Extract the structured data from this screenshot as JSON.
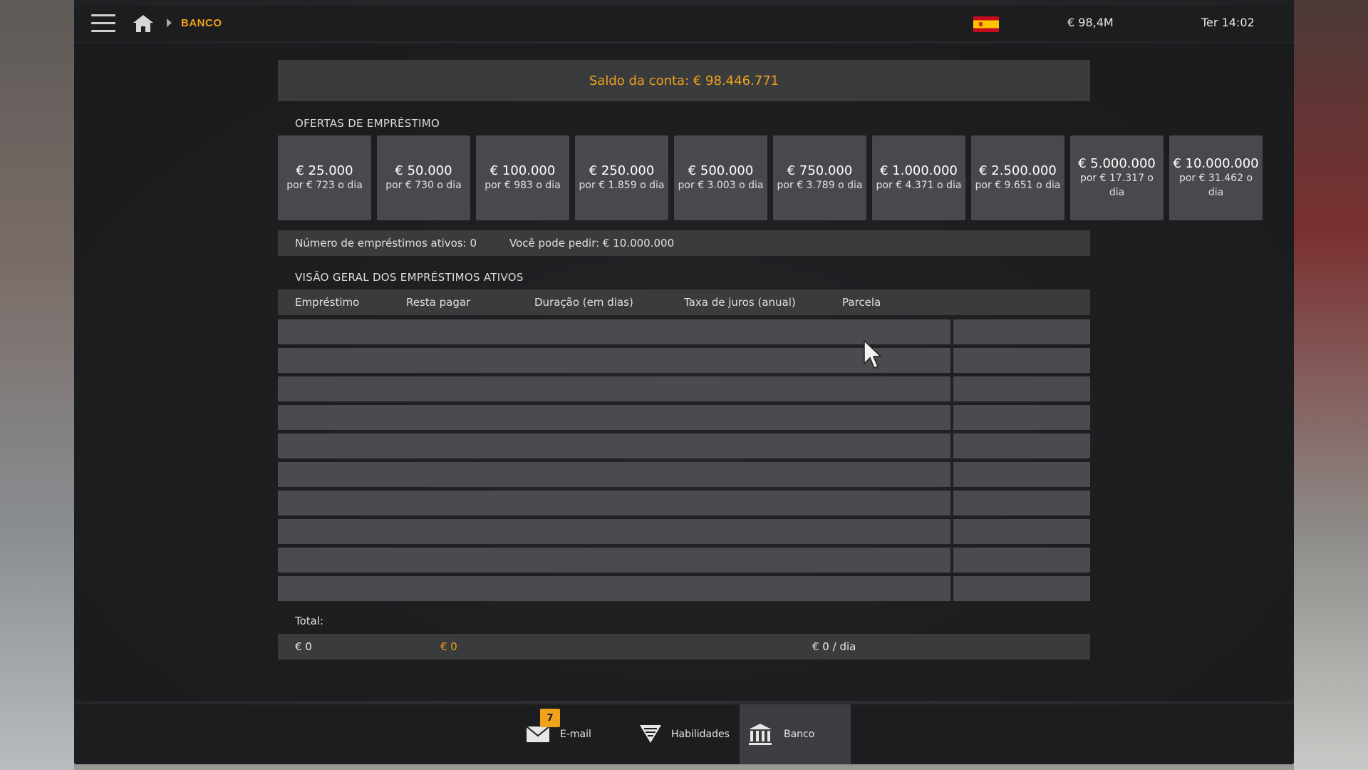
{
  "header": {
    "breadcrumb": "BANCO",
    "money": "€ 98,4M",
    "clock": "Ter 14:02",
    "flag_icon": "spain-flag-icon"
  },
  "balance": {
    "text": "Saldo da conta: € 98.446.771",
    "color": "#f0a21a"
  },
  "offers_title": "OFERTAS DE EMPRÉSTIMO",
  "offers": [
    {
      "amount": "€ 25.000",
      "rate": "por € 723 o dia"
    },
    {
      "amount": "€ 50.000",
      "rate": "por € 730 o dia"
    },
    {
      "amount": "€ 100.000",
      "rate": "por € 983 o dia"
    },
    {
      "amount": "€ 250.000",
      "rate": "por € 1.859 o dia"
    },
    {
      "amount": "€ 500.000",
      "rate": "por € 3.003 o dia"
    },
    {
      "amount": "€ 750.000",
      "rate": "por € 3.789 o dia"
    },
    {
      "amount": "€ 1.000.000",
      "rate": "por € 4.371 o dia"
    },
    {
      "amount": "€ 2.500.000",
      "rate": "por € 9.651 o dia"
    },
    {
      "amount": "€ 5.000.000",
      "rate": "por € 17.317 o dia"
    },
    {
      "amount": "€ 10.000.000",
      "rate": "por € 31.462 o dia"
    }
  ],
  "info": {
    "active_loans": "Número de empréstimos ativos: 0",
    "can_request": "Você pode pedir: € 10.000.000"
  },
  "overview_title": "VISÃO GERAL DOS EMPRÉSTIMOS ATIVOS",
  "table": {
    "headers": [
      "Empréstimo",
      "Resta pagar",
      "Duração (em dias)",
      "Taxa de juros (anual)",
      "Parcela"
    ]
  },
  "totals": {
    "label": "Total:",
    "loan": "€ 0",
    "remaining": "€ 0",
    "installment": "€ 0 / dia"
  },
  "dock": {
    "email_label": "E-mail",
    "email_badge": "7",
    "skills_label": "Habilidades",
    "bank_label": "Banco"
  }
}
